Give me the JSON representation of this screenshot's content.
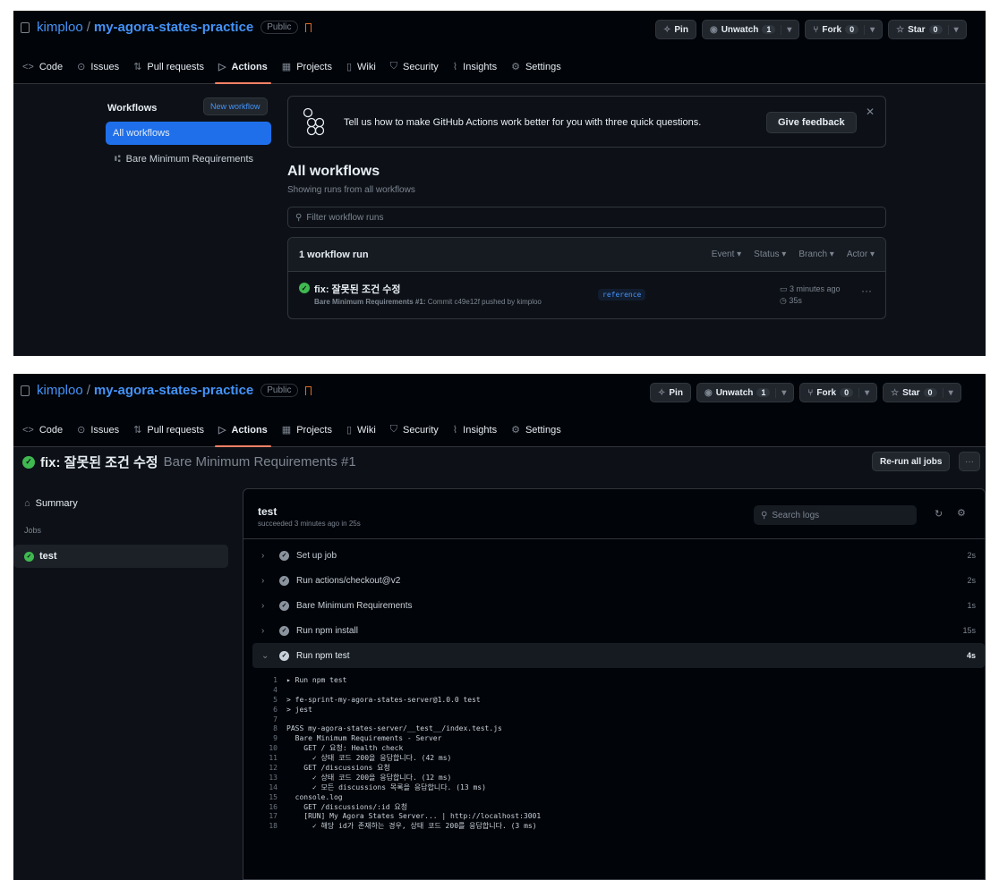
{
  "repo": {
    "owner": "kimploo",
    "name": "my-agora-states-practice",
    "visibility": "Public"
  },
  "header_buttons": {
    "pin": "Pin",
    "unwatch": "Unwatch",
    "unwatch_count": "1",
    "fork": "Fork",
    "fork_count": "0",
    "star": "Star",
    "star_count": "0"
  },
  "nav": [
    "Code",
    "Issues",
    "Pull requests",
    "Actions",
    "Projects",
    "Wiki",
    "Security",
    "Insights",
    "Settings"
  ],
  "shot1": {
    "sidebar_title": "Workflows",
    "new_workflow": "New workflow",
    "all_workflows": "All workflows",
    "workflow_item": "Bare Minimum Requirements",
    "feedback_text": "Tell us how to make GitHub Actions work better for you with three quick questions.",
    "feedback_button": "Give feedback",
    "main_title": "All workflows",
    "main_subtitle": "Showing runs from all workflows",
    "filter_placeholder": "Filter workflow runs",
    "runs_count": "1 workflow run",
    "filters": [
      "Event",
      "Status",
      "Branch",
      "Actor"
    ],
    "run": {
      "title": "fix: 잘못된 조건 수정",
      "meta_bold": "Bare Minimum Requirements #1:",
      "meta_rest": " Commit c49e12f pushed by kimploo",
      "branch": "reference",
      "time_ago": "3 minutes ago",
      "duration": "35s"
    }
  },
  "shot2": {
    "run_title": "fix: 잘못된 조건 수정",
    "run_subtitle": "Bare Minimum Requirements #1",
    "rerun": "Re-run all jobs",
    "summary": "Summary",
    "jobs_label": "Jobs",
    "job": "test",
    "job_status": "succeeded 3 minutes ago in 25s",
    "search_placeholder": "Search logs",
    "steps": [
      {
        "name": "Set up job",
        "dur": "2s"
      },
      {
        "name": "Run actions/checkout@v2",
        "dur": "2s"
      },
      {
        "name": "Bare Minimum Requirements",
        "dur": "1s"
      },
      {
        "name": "Run npm install",
        "dur": "15s"
      },
      {
        "name": "Run npm test",
        "dur": "4s"
      }
    ],
    "log_lines": [
      {
        "n": "1",
        "t": "▸ Run npm test"
      },
      {
        "n": "4",
        "t": ""
      },
      {
        "n": "5",
        "t": "> fe-sprint-my-agora-states-server@1.0.0 test"
      },
      {
        "n": "6",
        "t": "> jest"
      },
      {
        "n": "7",
        "t": ""
      },
      {
        "n": "8",
        "t": "PASS my-agora-states-server/__test__/index.test.js"
      },
      {
        "n": "9",
        "t": "  Bare Minimum Requirements - Server"
      },
      {
        "n": "10",
        "t": "    GET / 요청: Health check"
      },
      {
        "n": "11",
        "t": "      ✓ 상태 코드 200을 응답합니다. (42 ms)"
      },
      {
        "n": "12",
        "t": "    GET /discussions 요청"
      },
      {
        "n": "13",
        "t": "      ✓ 상태 코드 200을 응답합니다. (12 ms)"
      },
      {
        "n": "14",
        "t": "      ✓ 모든 discussions 목록을 응답합니다. (13 ms)"
      },
      {
        "n": "15",
        "t": "  console.log"
      },
      {
        "n": "16",
        "t": "    GET /discussions/:id 요청"
      },
      {
        "n": "17",
        "t": "    [RUN] My Agora States Server... | http://localhost:3001"
      },
      {
        "n": "18",
        "t": "      ✓ 해당 id가 존재하는 경우, 상태 코드 200를 응답합니다. (3 ms)"
      }
    ]
  }
}
